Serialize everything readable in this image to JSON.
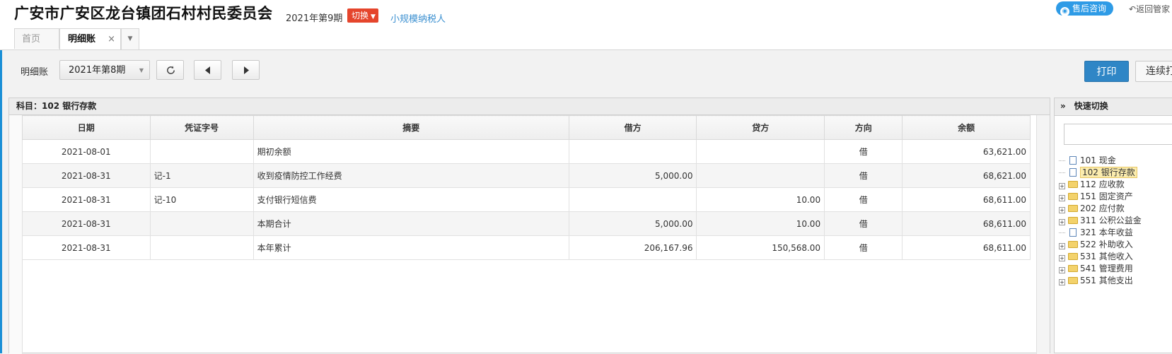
{
  "header": {
    "company": "广安市广安区龙台镇团石村村民委员会",
    "period": "2021年第9期",
    "switch_label": "切换",
    "taxpayer_type": "小规模纳税人",
    "consult_label": "售后咨询",
    "back_label": "返回管家"
  },
  "tabs": {
    "home": "首页",
    "detail": "明细账",
    "close_glyph": "×",
    "more_glyph": "▼"
  },
  "toolbar": {
    "label": "明细账",
    "period_value": "2021年第8期",
    "print_label": "打印",
    "continuous_label": "连续打印"
  },
  "ledger": {
    "subject": "科目：102 银行存款",
    "columns": [
      "日期",
      "凭证字号",
      "摘要",
      "借方",
      "贷方",
      "方向",
      "余额"
    ],
    "rows": [
      {
        "date": "2021-08-01",
        "voucher": "",
        "summary": "期初余额",
        "debit": "",
        "credit": "",
        "direction": "借",
        "balance": "63,621.00"
      },
      {
        "date": "2021-08-31",
        "voucher": "记-1",
        "summary": "收到疫情防控工作经费",
        "debit": "5,000.00",
        "credit": "",
        "direction": "借",
        "balance": "68,621.00"
      },
      {
        "date": "2021-08-31",
        "voucher": "记-10",
        "summary": "支付银行短信费",
        "debit": "",
        "credit": "10.00",
        "direction": "借",
        "balance": "68,611.00"
      },
      {
        "date": "2021-08-31",
        "voucher": "",
        "summary": "本期合计",
        "debit": "5,000.00",
        "credit": "10.00",
        "direction": "借",
        "balance": "68,611.00"
      },
      {
        "date": "2021-08-31",
        "voucher": "",
        "summary": "本年累计",
        "debit": "206,167.96",
        "credit": "150,568.00",
        "direction": "借",
        "balance": "68,611.00"
      }
    ]
  },
  "quick_switch": {
    "title": "快速切换",
    "title_icon": "»",
    "items": [
      {
        "code": "101",
        "name": "现金",
        "type": "doc",
        "expandable": false,
        "selected": false
      },
      {
        "code": "102",
        "name": "银行存款",
        "type": "doc",
        "expandable": false,
        "selected": true
      },
      {
        "code": "112",
        "name": "应收款",
        "type": "folder",
        "expandable": true,
        "selected": false
      },
      {
        "code": "151",
        "name": "固定资产",
        "type": "folder",
        "expandable": true,
        "selected": false
      },
      {
        "code": "202",
        "name": "应付款",
        "type": "folder",
        "expandable": true,
        "selected": false
      },
      {
        "code": "311",
        "name": "公积公益金",
        "type": "folder",
        "expandable": true,
        "selected": false
      },
      {
        "code": "321",
        "name": "本年收益",
        "type": "doc",
        "expandable": false,
        "selected": false
      },
      {
        "code": "522",
        "name": "补助收入",
        "type": "folder",
        "expandable": true,
        "selected": false
      },
      {
        "code": "531",
        "name": "其他收入",
        "type": "folder",
        "expandable": true,
        "selected": false
      },
      {
        "code": "541",
        "name": "管理费用",
        "type": "folder",
        "expandable": true,
        "selected": false
      },
      {
        "code": "551",
        "name": "其他支出",
        "type": "folder",
        "expandable": true,
        "selected": false
      }
    ]
  },
  "colors": {
    "accent_blue": "#2f86c6",
    "switch_red": "#e5452c",
    "link_blue": "#3a8fd0",
    "consult_blue": "#2e9be6"
  }
}
